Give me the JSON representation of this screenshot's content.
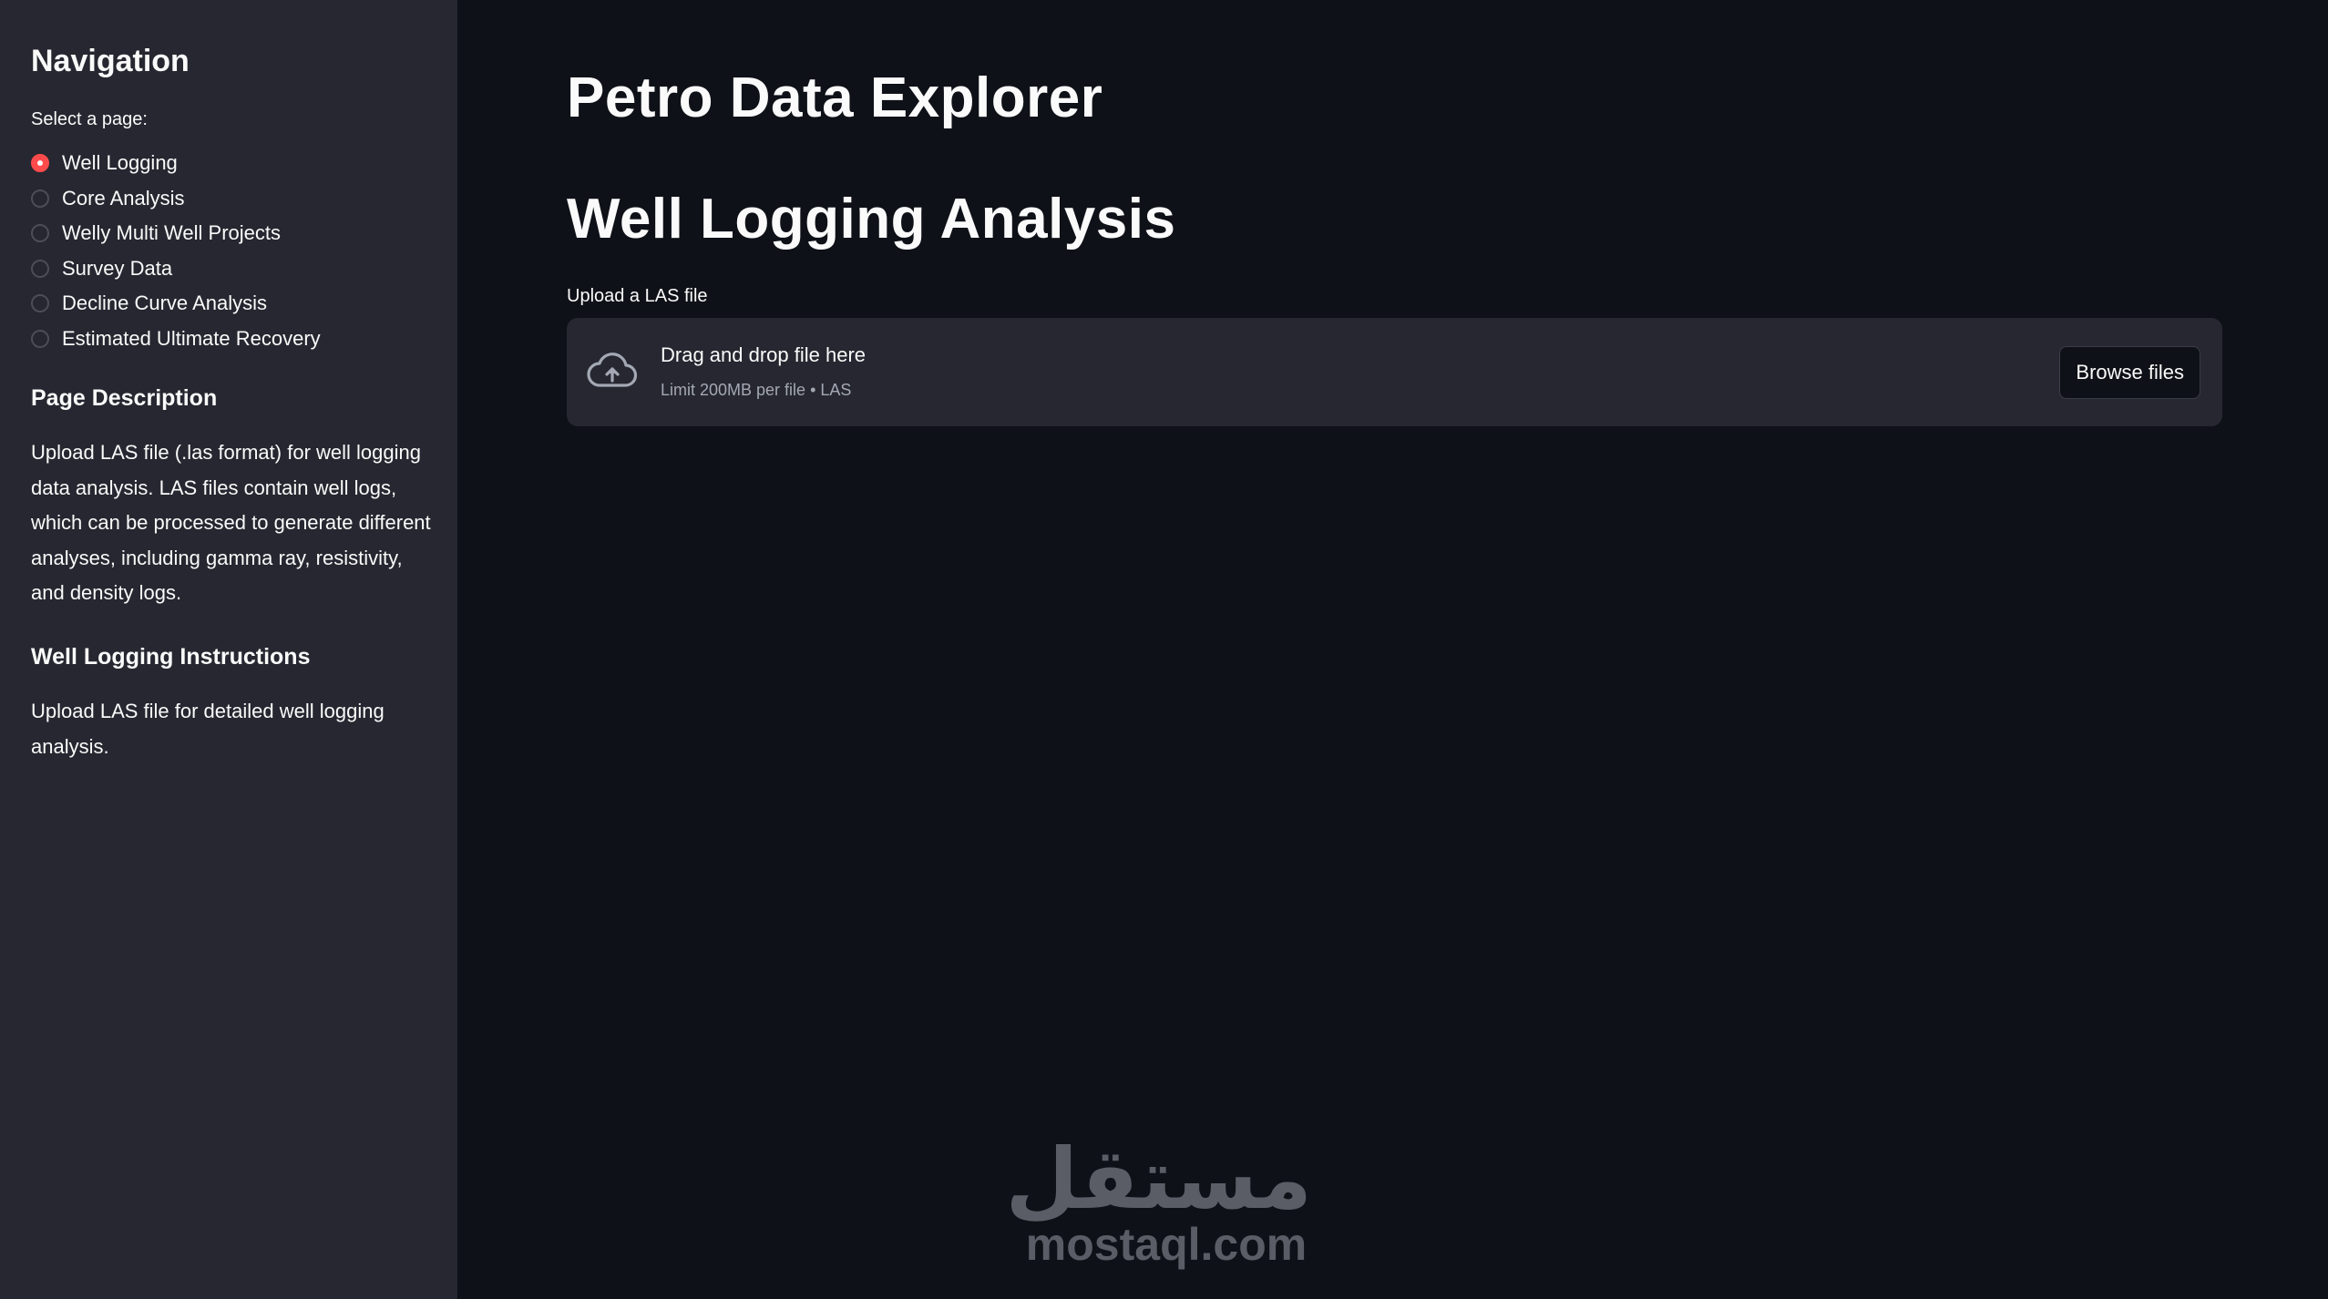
{
  "sidebar": {
    "nav_title": "Navigation",
    "select_label": "Select a page:",
    "pages": [
      {
        "label": "Well Logging",
        "selected": true
      },
      {
        "label": "Core Analysis",
        "selected": false
      },
      {
        "label": "Welly Multi Well Projects",
        "selected": false
      },
      {
        "label": "Survey Data",
        "selected": false
      },
      {
        "label": "Decline Curve Analysis",
        "selected": false
      },
      {
        "label": "Estimated Ultimate Recovery",
        "selected": false
      }
    ],
    "description_heading": "Page Description",
    "description_text": "Upload LAS file (.las format) for well logging data analysis. LAS files contain well logs, which can be processed to generate different analyses, including gamma ray, resistivity, and density logs.",
    "instructions_heading": "Well Logging Instructions",
    "instructions_text": "Upload LAS file for detailed well logging analysis."
  },
  "main": {
    "app_title": "Petro Data Explorer",
    "page_title": "Well Logging Analysis",
    "uploader": {
      "label": "Upload a LAS file",
      "dropzone_title": "Drag and drop file here",
      "limit_text": "Limit 200MB per file • LAS",
      "browse_label": "Browse files",
      "icon": "cloud-upload-icon"
    }
  },
  "watermark": {
    "arabic": "مستقل",
    "latin": "mostaql.com"
  },
  "colors": {
    "background": "#0e1117",
    "sidebar": "#262730",
    "accent": "#ff4b4b",
    "text": "#fafafa",
    "muted": "#a3a8b4"
  }
}
